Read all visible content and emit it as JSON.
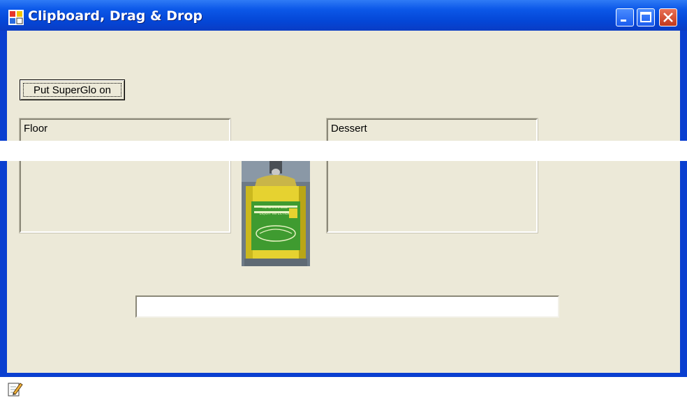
{
  "window": {
    "title": "Clipboard, Drag & Drop",
    "controls": [
      "minimize",
      "maximize",
      "close"
    ]
  },
  "main": {
    "superglo_button_label": "Put SuperGlo on",
    "floor_label": "Floor",
    "dessert_label": "Dessert",
    "text_input_value": "",
    "image": {
      "name": "superglo-can",
      "label_lines": [
        "INFLAMMABLE",
        "LIQUIT INFECTION"
      ]
    }
  },
  "footer": {
    "icon": "edit-icon"
  },
  "colors": {
    "titlebar": "#0c58e8",
    "client_bg": "#ece9d8",
    "close_button": "#c2381c",
    "can_yellow": "#e8d430",
    "can_green": "#3a9a2e"
  }
}
